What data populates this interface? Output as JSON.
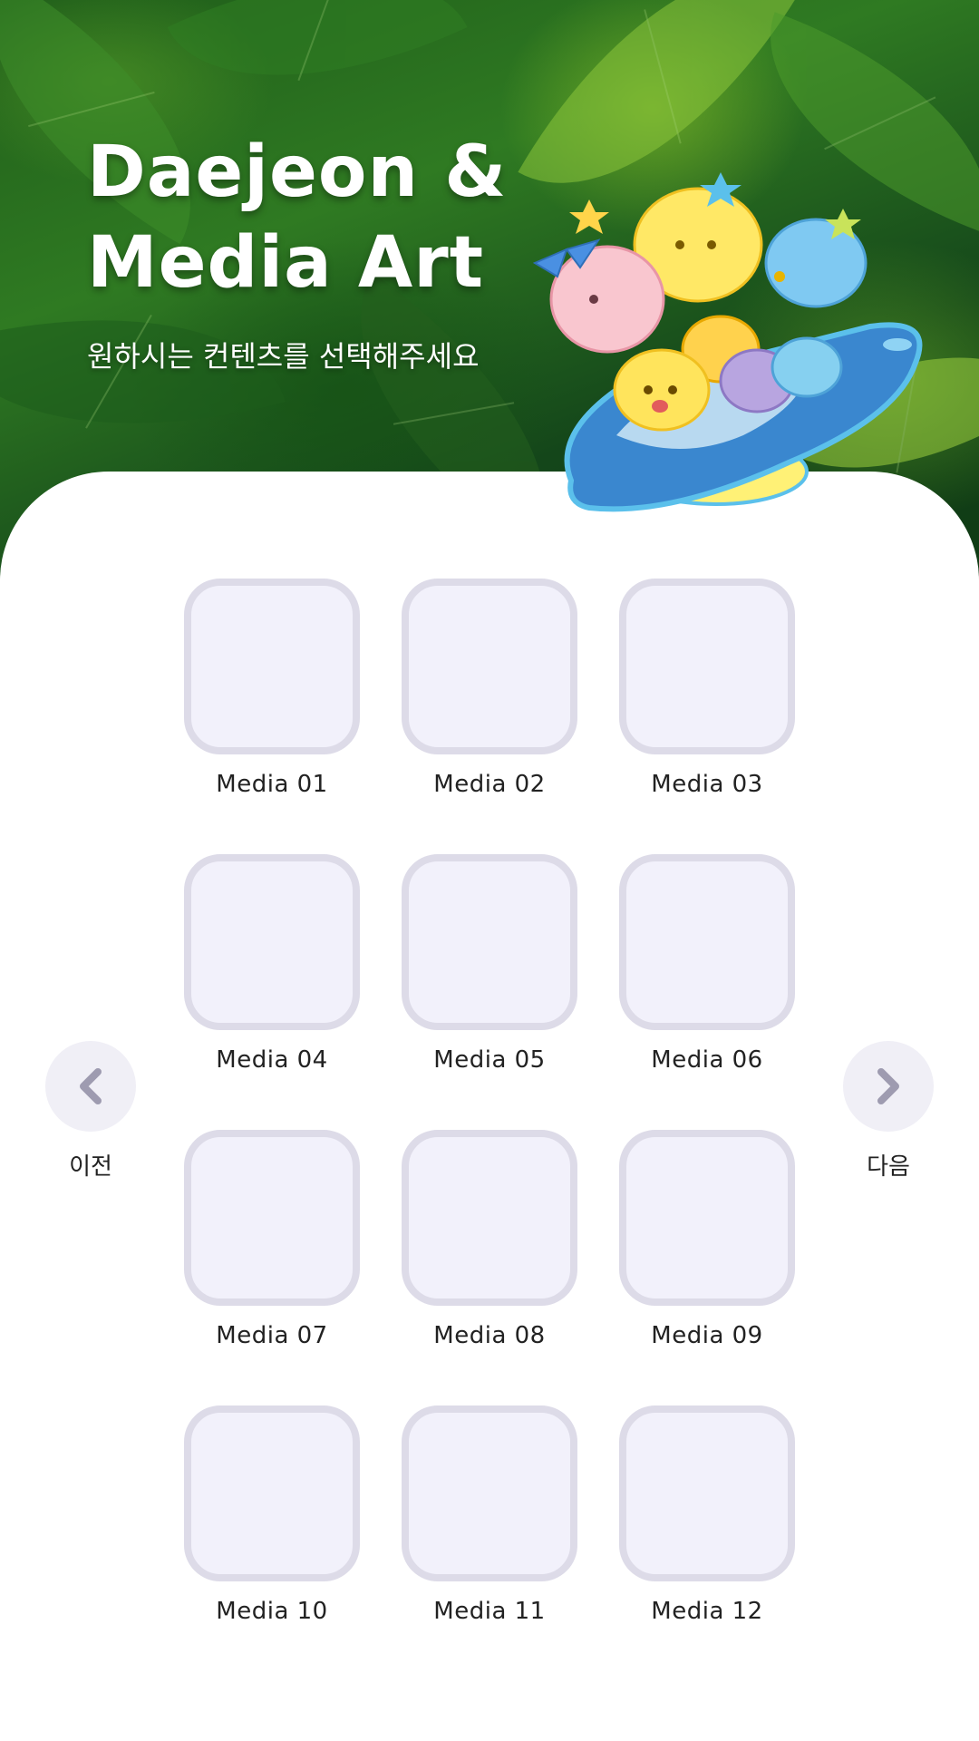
{
  "hero": {
    "title_line1": "Daejeon &",
    "title_line2": "Media Art",
    "subtitle": "원하시는 컨텐츠를 선택해주세요"
  },
  "media_grid": {
    "items": [
      {
        "label": "Media 01"
      },
      {
        "label": "Media 02"
      },
      {
        "label": "Media 03"
      },
      {
        "label": "Media 04"
      },
      {
        "label": "Media 05"
      },
      {
        "label": "Media 06"
      },
      {
        "label": "Media 07"
      },
      {
        "label": "Media 08"
      },
      {
        "label": "Media 09"
      },
      {
        "label": "Media 10"
      },
      {
        "label": "Media 11"
      },
      {
        "label": "Media 12"
      }
    ]
  },
  "navigation": {
    "prev_label": "이전",
    "next_label": "다음",
    "prev_icon": "chevron-left-icon",
    "next_icon": "chevron-right-icon"
  },
  "colors": {
    "tile_fill": "#f2f1fb",
    "tile_border": "#dddbe8",
    "nav_circle": "#f0eff6",
    "chevron": "#9e9bb0"
  }
}
